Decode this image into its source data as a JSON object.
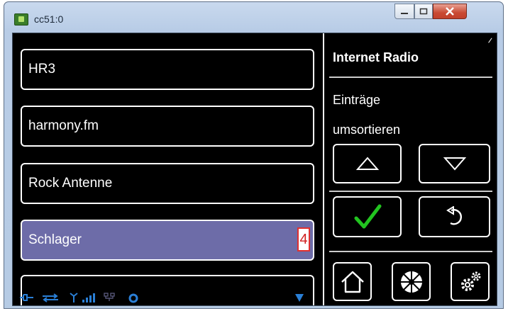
{
  "window": {
    "title": "cc51:0",
    "controls": {
      "minimize_icon": "minimize-icon",
      "maximize_icon": "maximize-icon",
      "close_icon": "close-icon"
    }
  },
  "list": {
    "items": [
      {
        "label": "HR3",
        "selected": false
      },
      {
        "label": "harmony.fm",
        "selected": false
      },
      {
        "label": "Rock Antenne",
        "selected": false
      },
      {
        "label": "Schlager",
        "selected": true,
        "badge": "4"
      },
      {
        "label": "",
        "selected": false
      }
    ]
  },
  "panel": {
    "title": "Internet Radio",
    "line1": "Einträge",
    "line2": "umsortieren",
    "buttons": {
      "up": "triangle-up-icon",
      "down": "triangle-down-icon",
      "confirm": "checkmark-icon",
      "back": "undo-icon",
      "home": "home-icon",
      "media": "media-disc-icon",
      "settings": "gears-icon"
    },
    "colors": {
      "confirm_check": "#22c420"
    }
  },
  "statusbar": {
    "icons": [
      "plug-icon",
      "network-link-icon",
      "antenna-icon",
      "signal-bars-icon",
      "lan-icon",
      "sync-icon",
      "scroll-down-icon"
    ],
    "accent": "#2a7fd6"
  },
  "colors": {
    "selected_row": "#6d6ca8",
    "badge_border": "#e03030"
  }
}
